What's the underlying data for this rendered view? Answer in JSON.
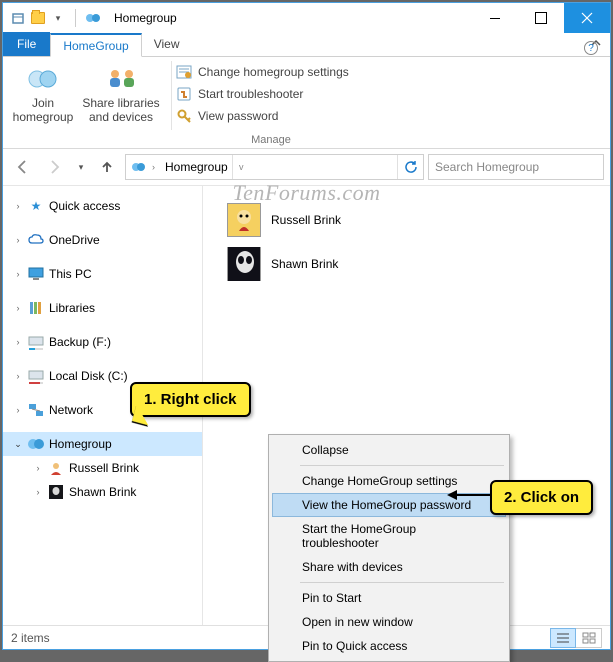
{
  "window": {
    "title": "Homegroup"
  },
  "menubar": {
    "file": "File",
    "tabs": [
      {
        "label": "HomeGroup",
        "active": true
      },
      {
        "label": "View",
        "active": false
      }
    ]
  },
  "ribbon": {
    "join": "Join\nhomegroup",
    "share": "Share libraries\nand devices",
    "change": "Change homegroup settings",
    "troubleshoot": "Start troubleshooter",
    "viewpw": "View password",
    "group_label": "Manage"
  },
  "address": {
    "crumb": "Homegroup",
    "search_placeholder": "Search Homegroup"
  },
  "tree": {
    "quick_access": "Quick access",
    "onedrive": "OneDrive",
    "this_pc": "This PC",
    "libraries": "Libraries",
    "backup": "Backup (F:)",
    "local_disk": "Local Disk (C:)",
    "network": "Network",
    "homegroup": "Homegroup",
    "children": [
      "Russell Brink",
      "Shawn Brink"
    ]
  },
  "content_items": [
    {
      "name": "Russell Brink"
    },
    {
      "name": "Shawn Brink"
    }
  ],
  "status": {
    "count": "2 items"
  },
  "context_menu": {
    "items": [
      "Collapse",
      "Change HomeGroup settings",
      "View the HomeGroup password",
      "Start the HomeGroup troubleshooter",
      "Share with devices",
      "Pin to Start",
      "Open in new window",
      "Pin to Quick access"
    ]
  },
  "callouts": {
    "c1": "1. Right click",
    "c2": "2. Click on"
  },
  "watermark": "TenForums.com"
}
